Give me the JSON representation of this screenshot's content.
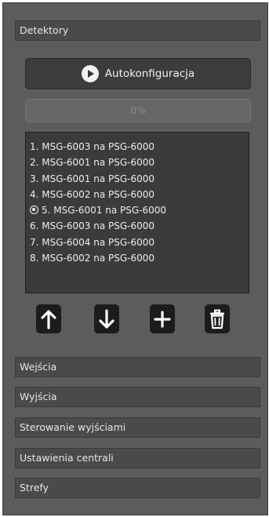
{
  "sections": {
    "detectors": {
      "label": "Detektory"
    },
    "inputs": {
      "label": "Wejścia"
    },
    "outputs": {
      "label": "Wyjścia"
    },
    "output_control": {
      "label": "Sterowanie wyjściami"
    },
    "panel_settings": {
      "label": "Ustawienia centrali"
    },
    "zones": {
      "label": "Strefy"
    }
  },
  "autoconfig": {
    "label": "Autokonfiguracja",
    "icon": "play-icon"
  },
  "progress": {
    "value": 0,
    "label": "0%"
  },
  "detectors": {
    "selected_index": 4,
    "items": [
      {
        "label": "1. MSG-6003 na PSG-6000"
      },
      {
        "label": "2. MSG-6001 na PSG-6000"
      },
      {
        "label": "3. MSG-6001 na PSG-6000"
      },
      {
        "label": "4. MSG-6002 na PSG-6000"
      },
      {
        "label": "5. MSG-6001 na PSG-6000"
      },
      {
        "label": "6. MSG-6003 na PSG-6000"
      },
      {
        "label": "7. MSG-6004 na PSG-6000"
      },
      {
        "label": "8. MSG-6002 na PSG-6000"
      }
    ]
  },
  "list_actions": {
    "icons": [
      "arrow-up-icon",
      "arrow-down-icon",
      "plus-icon",
      "trash-icon"
    ]
  },
  "colors": {
    "panel_bg": "#5c5c5c",
    "header_bg": "#4a4a4a",
    "list_bg": "#3b3b3b",
    "button_bg": "#1c1c1c",
    "text": "#ececec"
  }
}
